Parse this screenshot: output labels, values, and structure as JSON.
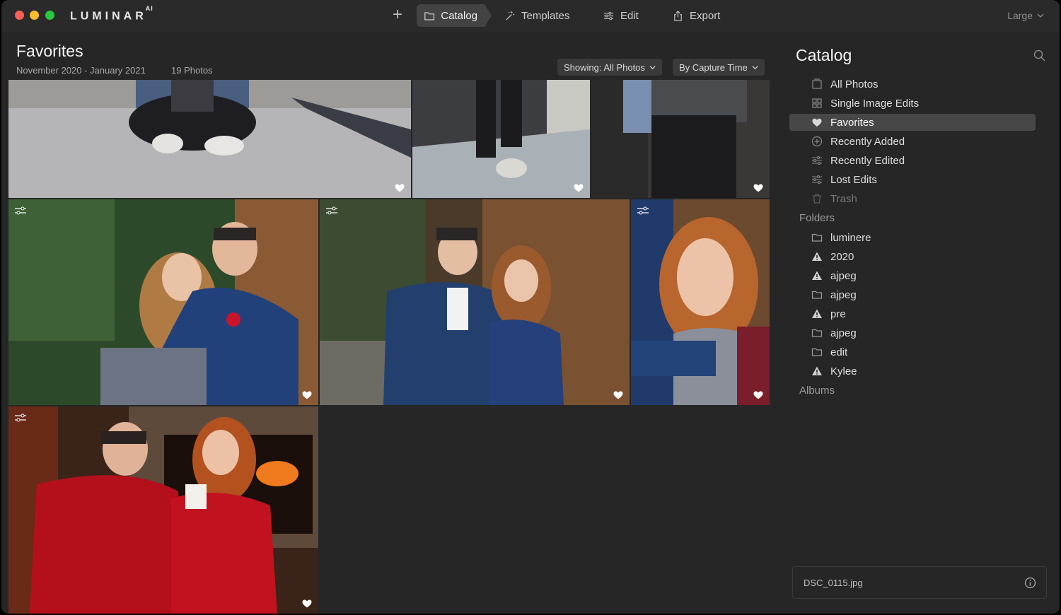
{
  "app": {
    "name": "LUMINAR",
    "suffix": "AI"
  },
  "toolbar": {
    "add_label": "+",
    "tabs": [
      {
        "label": "Catalog",
        "icon": "folder-icon",
        "active": true
      },
      {
        "label": "Templates",
        "icon": "magic-wand-icon",
        "active": false
      },
      {
        "label": "Edit",
        "icon": "sliders-icon",
        "active": false
      },
      {
        "label": "Export",
        "icon": "share-icon",
        "active": false
      }
    ],
    "thumbnail_size": "Large"
  },
  "header": {
    "title": "Favorites",
    "date_range": "November 2020 - January 2021",
    "photo_count": "19 Photos",
    "showing_filter": "Showing: All Photos",
    "sort_by": "By Capture Time"
  },
  "photos": [
    {
      "subject": "sneakers-on-pavement",
      "favorite": true,
      "edited": false
    },
    {
      "subject": "legs-against-brick-wall",
      "favorite": true,
      "edited": false
    },
    {
      "subject": "torso-against-brick-wall",
      "favorite": true,
      "edited": false
    },
    {
      "subject": "couple-embrace-outdoors",
      "favorite": true,
      "edited": true
    },
    {
      "subject": "couple-by-log-cabin",
      "favorite": true,
      "edited": true
    },
    {
      "subject": "woman-smiling-closeup",
      "favorite": true,
      "edited": true
    },
    {
      "subject": "couple-by-fireplace",
      "favorite": true,
      "edited": true
    }
  ],
  "sidebar": {
    "title": "Catalog",
    "items": [
      {
        "label": "All Photos",
        "icon": "photos-icon",
        "active": false,
        "dim": false
      },
      {
        "label": "Single Image Edits",
        "icon": "grid-icon",
        "active": false,
        "dim": false
      },
      {
        "label": "Favorites",
        "icon": "heart-icon",
        "active": true,
        "dim": false
      },
      {
        "label": "Recently Added",
        "icon": "plus-circle-icon",
        "active": false,
        "dim": false
      },
      {
        "label": "Recently Edited",
        "icon": "sliders-icon",
        "active": false,
        "dim": false
      },
      {
        "label": "Lost Edits",
        "icon": "sliders-icon",
        "active": false,
        "dim": false
      },
      {
        "label": "Trash",
        "icon": "trash-icon",
        "active": false,
        "dim": true
      }
    ],
    "folders_label": "Folders",
    "folders": [
      {
        "label": "luminere",
        "icon": "folder-icon"
      },
      {
        "label": "2020",
        "icon": "warning-icon"
      },
      {
        "label": "ajpeg",
        "icon": "warning-icon"
      },
      {
        "label": "ajpeg",
        "icon": "folder-icon"
      },
      {
        "label": "pre",
        "icon": "warning-icon"
      },
      {
        "label": "ajpeg",
        "icon": "folder-icon"
      },
      {
        "label": "edit",
        "icon": "folder-icon"
      },
      {
        "label": "Kylee",
        "icon": "warning-icon"
      }
    ],
    "albums_label": "Albums",
    "selected_file": "DSC_0115.jpg"
  },
  "colors": {
    "background": "#262626",
    "active_item": "#474747",
    "accent_tab": "#434343"
  }
}
